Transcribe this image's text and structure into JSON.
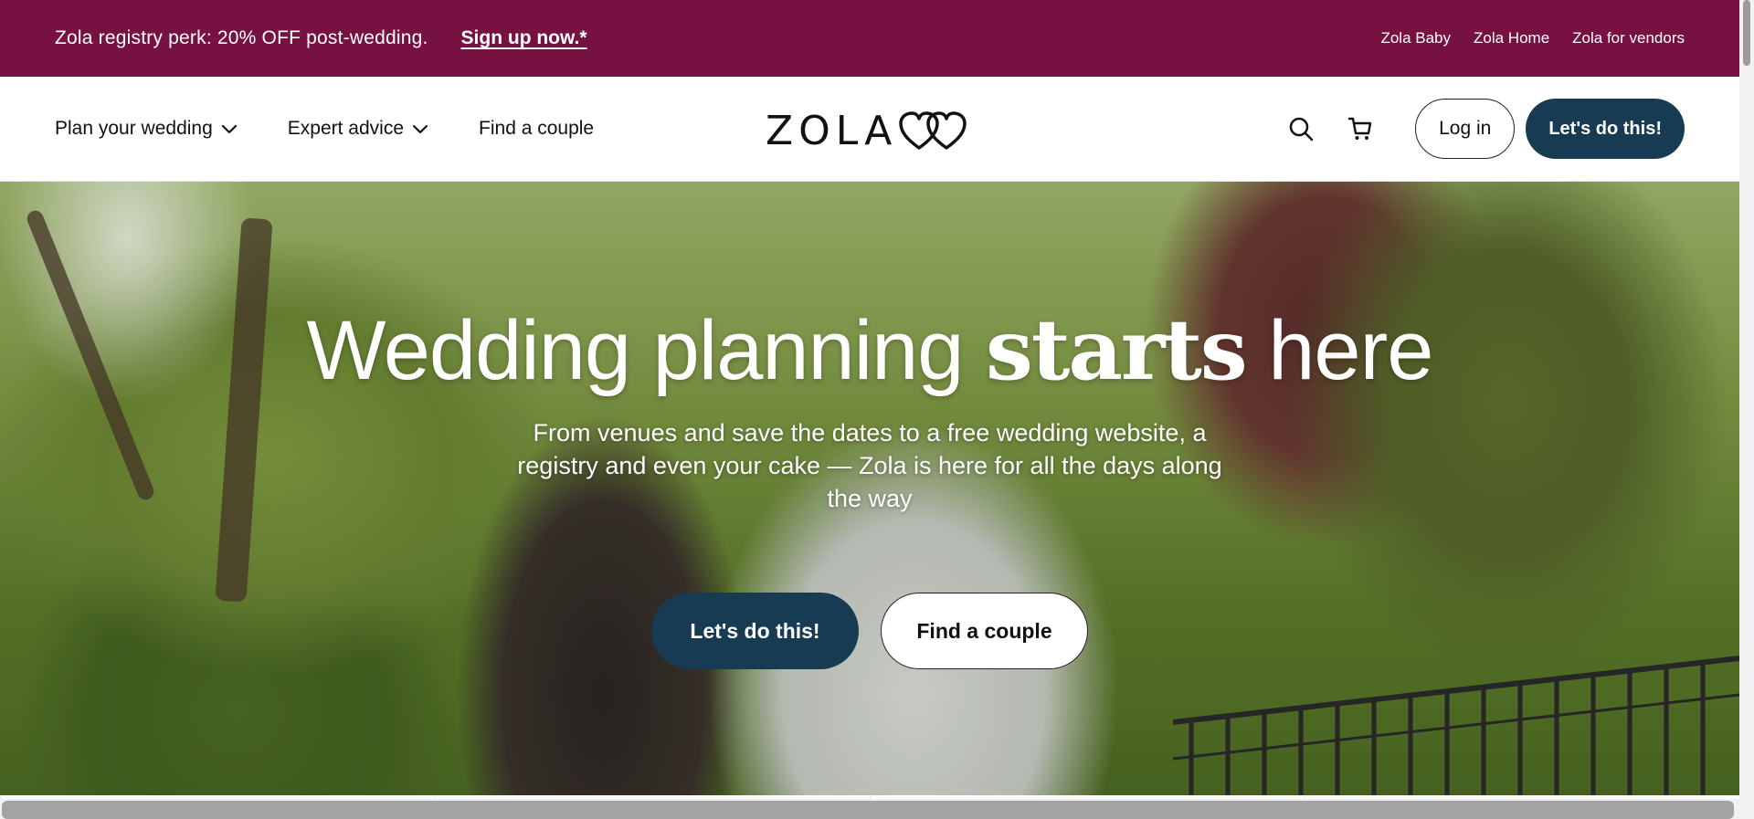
{
  "promo": {
    "text": "Zola registry perk: 20% OFF post-wedding.",
    "link": "Sign up now.*",
    "right_links": [
      "Zola Baby",
      "Zola Home",
      "Zola for vendors"
    ]
  },
  "header": {
    "nav": {
      "plan": "Plan your wedding",
      "advice": "Expert advice",
      "find": "Find a couple"
    },
    "logo": "ZOLA",
    "login": "Log in",
    "cta": "Let's do this!"
  },
  "hero": {
    "title_part1": "Wedding planning ",
    "title_accent": "starts",
    "title_part2": " here",
    "subtitle": "From venues and save the dates to a free wedding website, a registry and even your cake — Zola is here for all the days along the way",
    "primary_button": "Let's do this!",
    "secondary_button": "Find a couple"
  },
  "colors": {
    "promo_bg": "#771142",
    "primary_navy": "#183b54",
    "text_dark": "#111111"
  },
  "icons": [
    "chevron-down-icon",
    "search-icon",
    "cart-icon",
    "heart-logo-icon"
  ]
}
